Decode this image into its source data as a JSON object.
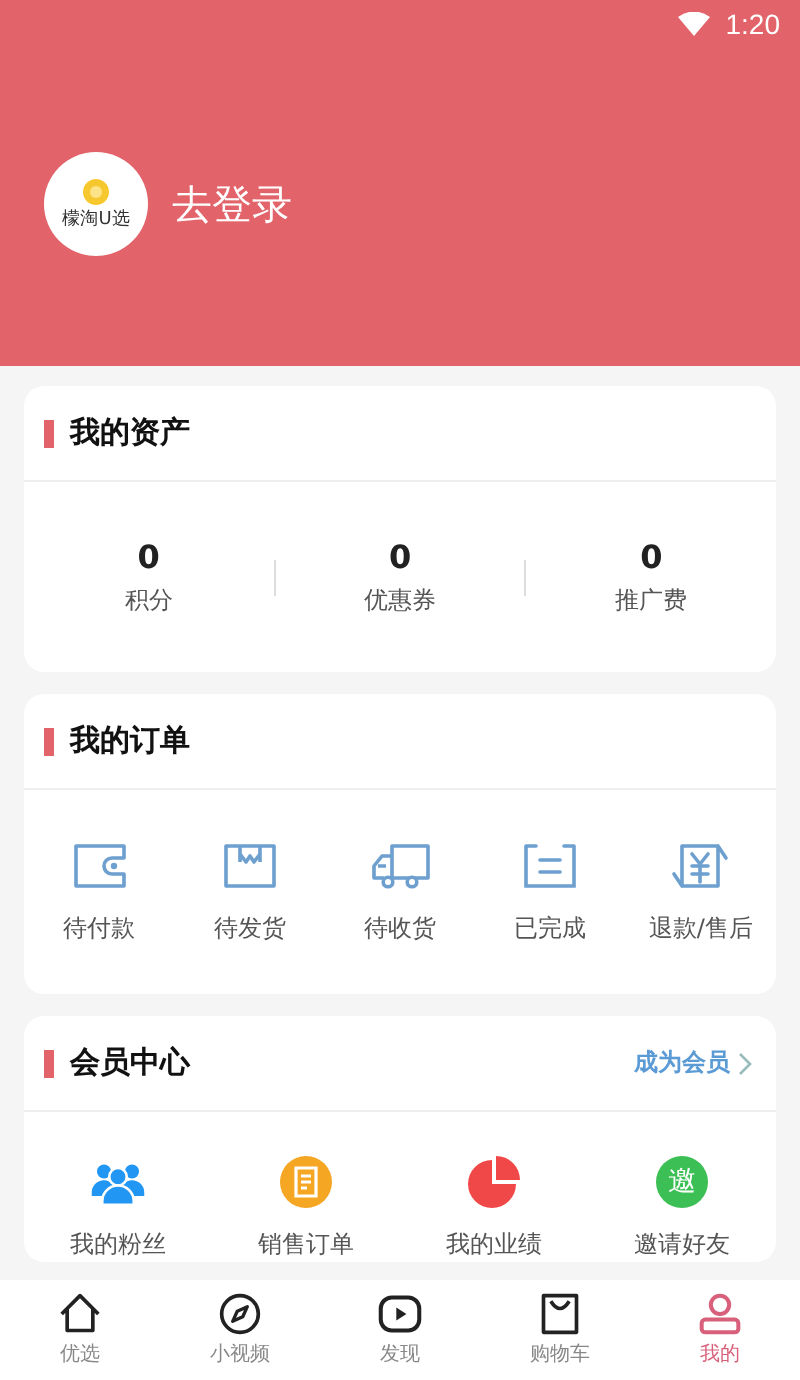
{
  "status_bar": {
    "time": "1:20"
  },
  "profile": {
    "logo_text": "檬淘U选",
    "login_label": "去登录"
  },
  "assets": {
    "title": "我的资产",
    "stats": [
      {
        "value": "0",
        "label": "积分"
      },
      {
        "value": "0",
        "label": "优惠券"
      },
      {
        "value": "0",
        "label": "推广费"
      }
    ]
  },
  "orders": {
    "title": "我的订单",
    "items": [
      {
        "kind": "wallet",
        "label": "待付款"
      },
      {
        "kind": "box",
        "label": "待发货"
      },
      {
        "kind": "truck",
        "label": "待收货"
      },
      {
        "kind": "list",
        "label": "已完成"
      },
      {
        "kind": "refund",
        "label": "退款/售后"
      }
    ]
  },
  "member": {
    "title": "会员中心",
    "link": "成为会员",
    "items": [
      {
        "kind": "fans",
        "label": "我的粉丝",
        "color": "#2196f3"
      },
      {
        "kind": "order",
        "label": "销售订单",
        "color": "#f5a623"
      },
      {
        "kind": "chart",
        "label": "我的业绩",
        "color": "#f04848"
      },
      {
        "kind": "invite",
        "label": "邀请好友",
        "color": "#3cbf55",
        "glyph": "邀"
      }
    ]
  },
  "tab_bar": [
    {
      "kind": "home",
      "label": "优选",
      "selected": false
    },
    {
      "kind": "compass",
      "label": "小视频",
      "selected": false
    },
    {
      "kind": "play",
      "label": "发现",
      "selected": false
    },
    {
      "kind": "bag",
      "label": "购物车",
      "selected": false
    },
    {
      "kind": "person",
      "label": "我的",
      "selected": true
    }
  ]
}
